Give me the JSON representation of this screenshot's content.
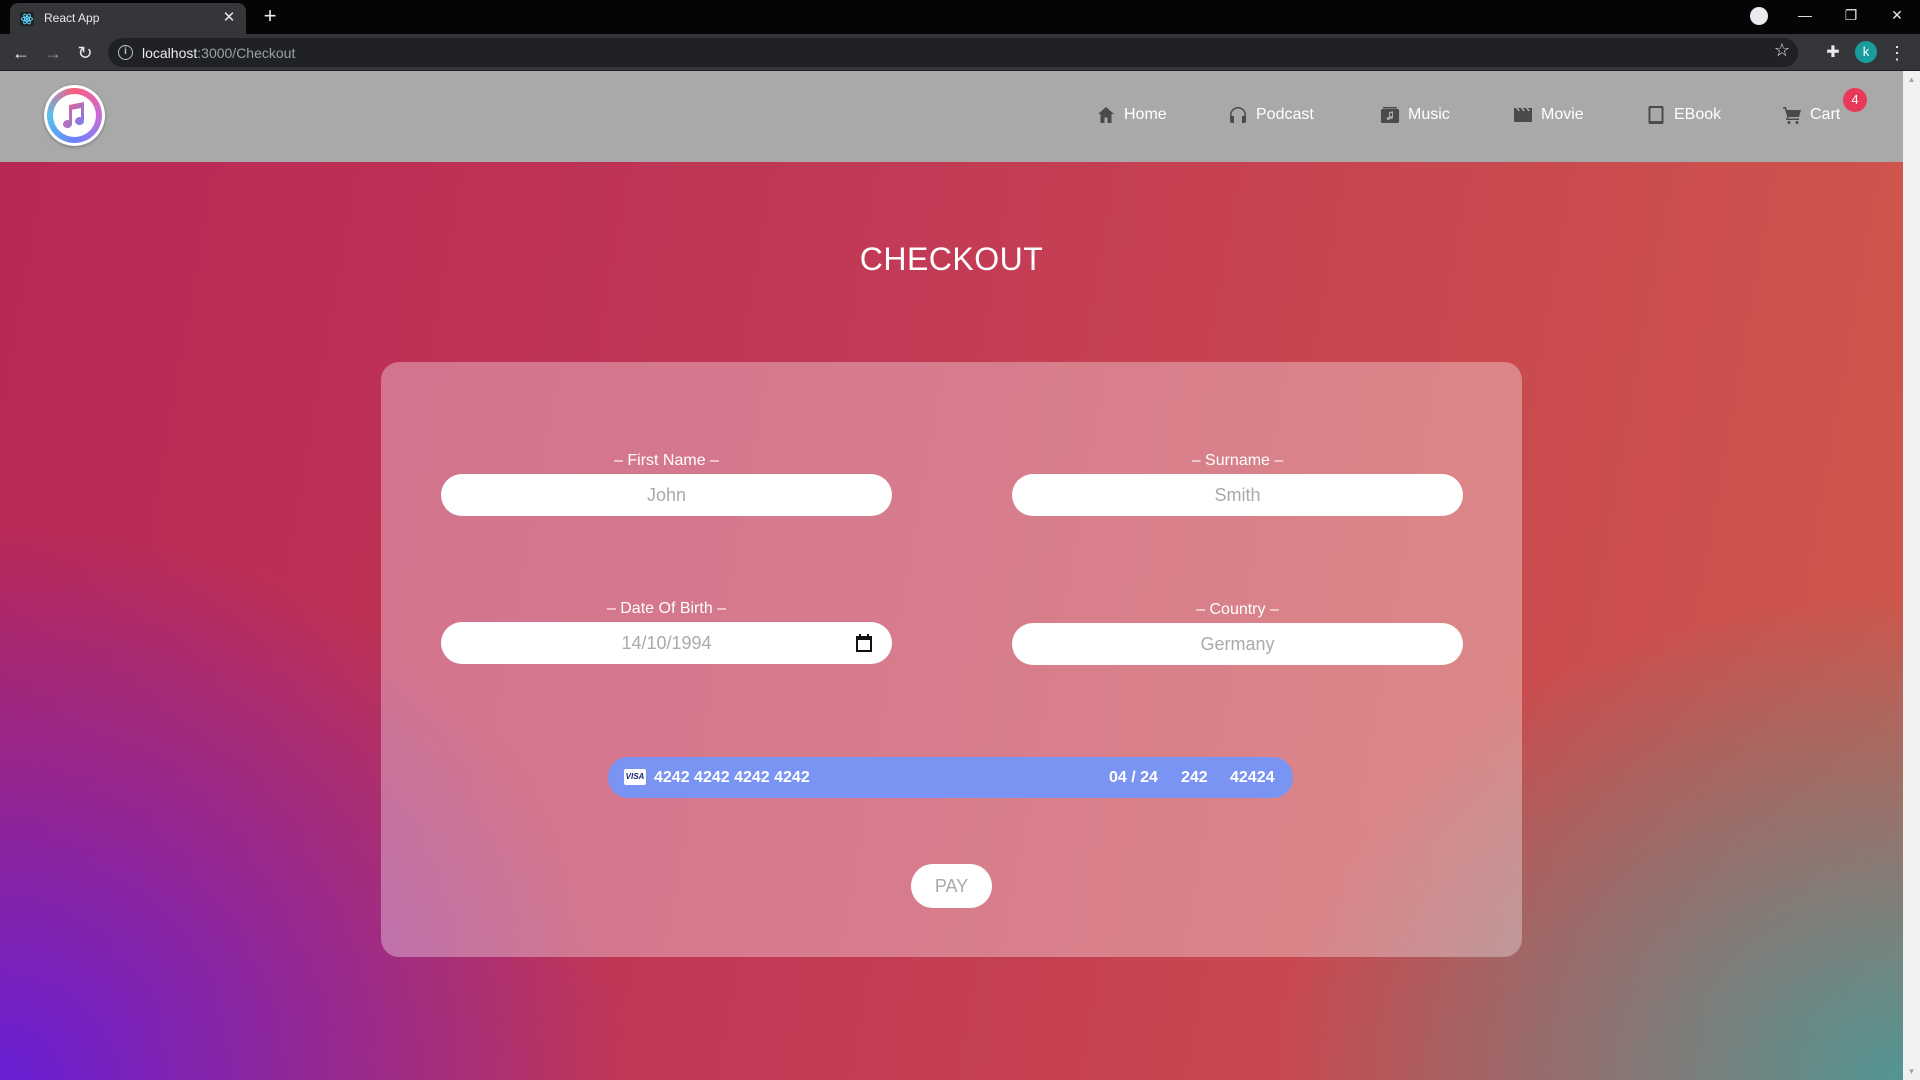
{
  "browser": {
    "tab_title": "React App",
    "url_host": "localhost",
    "url_path": ":3000/Checkout"
  },
  "nav": {
    "items": [
      {
        "label": "Home",
        "icon": "home-icon"
      },
      {
        "label": "Podcast",
        "icon": "headphones-icon"
      },
      {
        "label": "Music",
        "icon": "music-icon"
      },
      {
        "label": "Movie",
        "icon": "clapperboard-icon"
      },
      {
        "label": "EBook",
        "icon": "tablet-icon"
      },
      {
        "label": "Cart",
        "icon": "cart-icon"
      }
    ],
    "cart_count": "4"
  },
  "page": {
    "title": "CHECKOUT"
  },
  "form": {
    "first_name": {
      "label": "– First Name –",
      "placeholder": "John"
    },
    "surname": {
      "label": "– Surname –",
      "placeholder": "Smith"
    },
    "dob": {
      "label": "– Date Of Birth –",
      "placeholder": "14/10/1994"
    },
    "country": {
      "label": "– Country –",
      "placeholder": "Germany"
    },
    "card": {
      "brand": "VISA",
      "number": "4242 4242 4242 4242",
      "expiry": "04 / 24",
      "cvc": "242",
      "zip": "42424"
    },
    "pay_label": "PAY"
  },
  "colors": {
    "navbar": "#a9a9a9",
    "card_bar": "#7a94f4",
    "badge": "#e8395a"
  }
}
